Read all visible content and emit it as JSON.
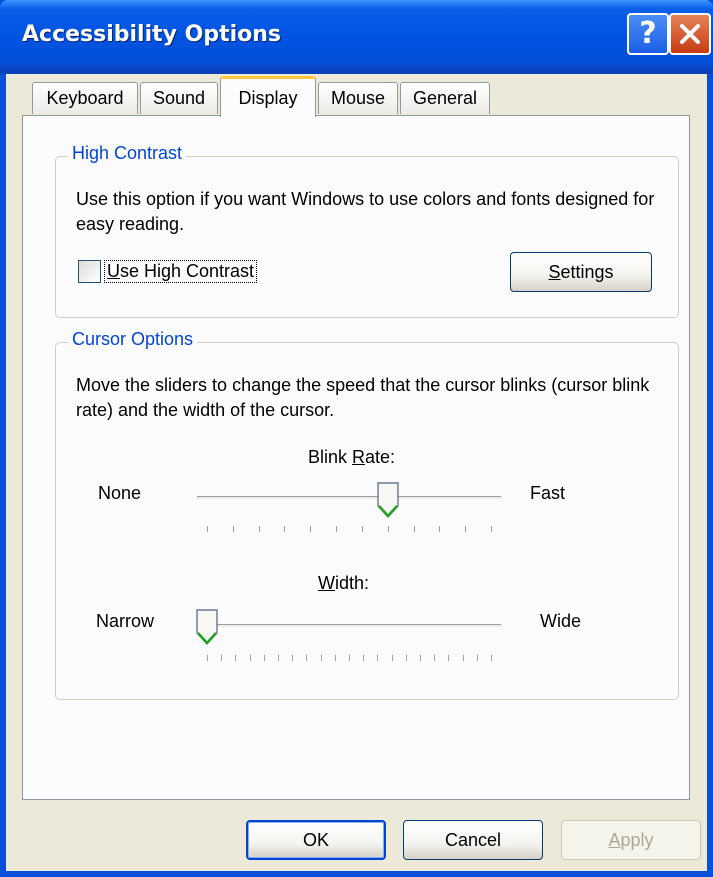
{
  "window": {
    "title": "Accessibility Options"
  },
  "title_buttons": {
    "help_glyph": "?"
  },
  "tabs": [
    {
      "label": "Keyboard",
      "active": false
    },
    {
      "label": "Sound",
      "active": false
    },
    {
      "label": "Display",
      "active": true
    },
    {
      "label": "Mouse",
      "active": false
    },
    {
      "label": "General",
      "active": false
    }
  ],
  "high_contrast": {
    "legend": "High Contrast",
    "description": "Use this option if you want Windows to use colors and fonts designed for easy reading.",
    "checkbox": {
      "label_mnemonic": "U",
      "label_rest": "se High Contrast",
      "checked": false
    },
    "settings_button": {
      "mnemonic": "S",
      "rest": "ettings"
    }
  },
  "cursor_options": {
    "legend": "Cursor Options",
    "description": "Move the sliders to change the speed that the cursor blinks (cursor blink rate) and the width of the cursor.",
    "blink_rate": {
      "label_pre": "Blink ",
      "label_mnemonic": "R",
      "label_post": "ate:",
      "min_label": "None",
      "max_label": "Fast",
      "value": 7,
      "min": 0,
      "max": 11
    },
    "width": {
      "label_mnemonic": "W",
      "label_post": "idth:",
      "min_label": "Narrow",
      "max_label": "Wide",
      "value": 0,
      "min": 0,
      "max": 20
    }
  },
  "buttons": {
    "ok": "OK",
    "cancel": "Cancel",
    "apply_mnemonic": "A",
    "apply_rest": "pply"
  },
  "colors": {
    "titlebar": "#0054e3",
    "legend_text": "#0046d5",
    "active_tab_accent": "#ffc83c",
    "slider_thumb_accent": "#21a121"
  }
}
